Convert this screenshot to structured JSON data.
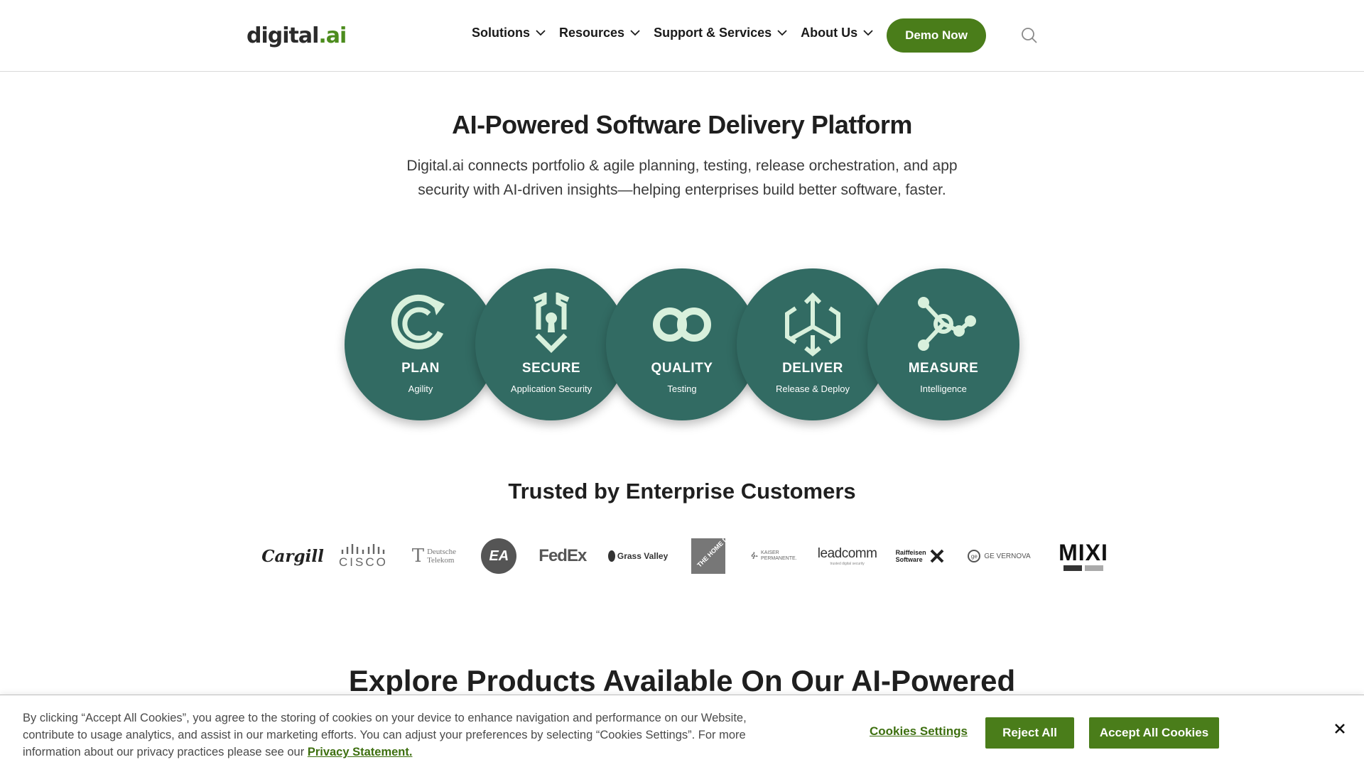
{
  "header": {
    "logo_text": "digital",
    "logo_suffix": ".ai",
    "nav": [
      {
        "label": "Solutions"
      },
      {
        "label": "Resources"
      },
      {
        "label": "Support & Services"
      },
      {
        "label": "About Us"
      }
    ],
    "demo_label": "Demo Now",
    "search_icon": "search-icon"
  },
  "hero": {
    "title": "AI-Powered Software Delivery Platform",
    "subtitle": "Digital.ai connects portfolio & agile planning, testing, release orchestration, and app security with AI-driven insights—helping enterprises build better software, faster."
  },
  "pillars": [
    {
      "label": "PLAN",
      "sub": "Agility",
      "icon": "refresh-arc-icon"
    },
    {
      "label": "SECURE",
      "sub": "Application Security",
      "icon": "shield-lock-icon"
    },
    {
      "label": "QUALITY",
      "sub": "Testing",
      "icon": "infinity-loop-icon"
    },
    {
      "label": "DELIVER",
      "sub": "Release & Deploy",
      "icon": "cube-arrows-icon"
    },
    {
      "label": "MEASURE",
      "sub": "Intelligence",
      "icon": "network-nodes-icon"
    }
  ],
  "colors": {
    "brand_green": "#4a7d1a",
    "pillar_teal": "#326b63",
    "icon_mint": "#d8f0dc"
  },
  "trusted": {
    "title": "Trusted by Enterprise Customers",
    "logos": [
      "Cargill",
      "CISCO",
      "Deutsche Telekom",
      "EA",
      "FedEx",
      "Grass Valley",
      "The Home Depot",
      "KAISER PERMANENTE",
      "leadcomm",
      "Raiffeisen Software",
      "GE VERNOVA",
      "MIXI"
    ],
    "extra": {
      "deutsche_line1": "Deutsche",
      "deutsche_line2": "Telekom",
      "leadcomm_tag": "trusted digital security",
      "kaiser_line1": "KAISER",
      "kaiser_line2": "PERMANENTE.",
      "raiff_line1": "Raiffeisen",
      "raiff_line2": "Software",
      "homedepot_text": "THE HOME DEPOT"
    }
  },
  "explore": {
    "title": "Explore Products Available On Our AI-Powered"
  },
  "cookie": {
    "text": "By clicking “Accept All Cookies”, you agree to the storing of cookies on your device to enhance navigation and performance on our Website, contribute to usage analytics, and assist in our marketing efforts. You can adjust your preferences by selecting “Cookies Settings”. For more information about our privacy practices please see our",
    "privacy_link": "Privacy Statement.",
    "settings_label": "Cookies Settings",
    "reject_label": "Reject All",
    "accept_label": "Accept All Cookies"
  }
}
